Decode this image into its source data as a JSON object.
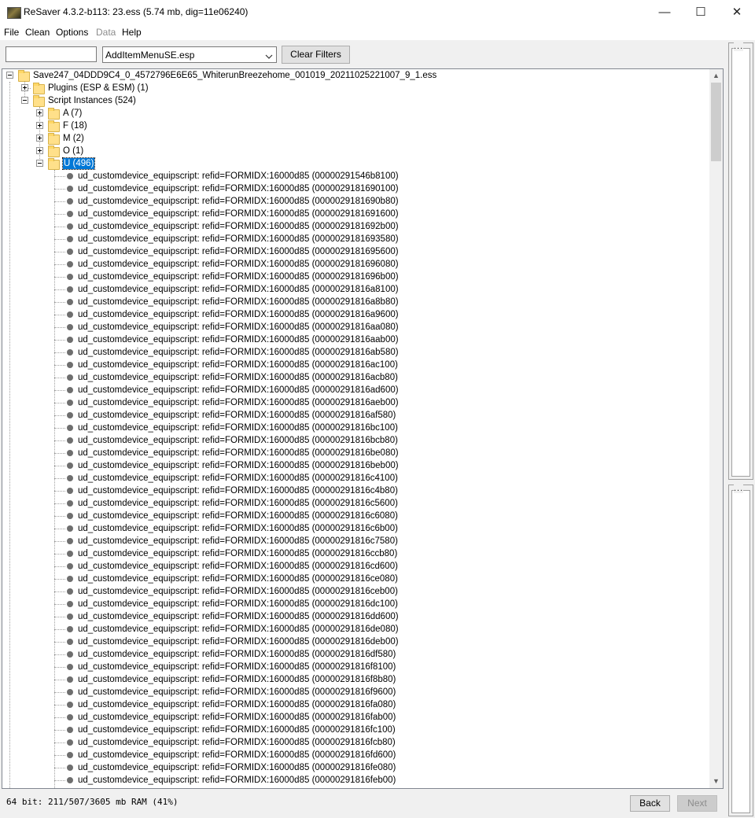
{
  "window": {
    "title": "ReSaver 4.3.2-b113: 23.ess (5.74 mb, dig=11e06240)",
    "minimize": "—",
    "maximize": "☐",
    "close": "✕"
  },
  "menu": [
    {
      "label": "File",
      "enabled": true
    },
    {
      "label": "Clean",
      "enabled": true
    },
    {
      "label": "Options",
      "enabled": true
    },
    {
      "label": "Data",
      "enabled": false
    },
    {
      "label": "Help",
      "enabled": true
    }
  ],
  "toolbar": {
    "filter_value": "",
    "plugin_select_value": "AddItemMenuSE.esp",
    "clear_filters_label": "Clear Filters"
  },
  "tree": {
    "root": "Save247_04DDD9C4_0_4572796E6E65_WhiterunBreezehome_001019_20211025221007_9_1.ess",
    "plugins": "Plugins (ESP & ESM) (1)",
    "script_instances": "Script Instances (524)",
    "groups": [
      {
        "label": "A (7)",
        "expanded": false
      },
      {
        "label": "F (18)",
        "expanded": false
      },
      {
        "label": "M (2)",
        "expanded": false
      },
      {
        "label": "O (1)",
        "expanded": false
      },
      {
        "label": "U (496)",
        "expanded": true,
        "selected": true
      }
    ],
    "item_prefix": "ud_customdevice_equipscript: refid=FORMIDX:16000d85",
    "items": [
      "(00000291546b8100)",
      "(0000029181690100)",
      "(00000291816​90b80)",
      "(0000029181691600)",
      "(0000029181692b00)",
      "(0000029181693580)",
      "(0000029181695600)",
      "(0000029181696080)",
      "(0000029181696b00)",
      "(00000291816a8100)",
      "(00000291816a8b80)",
      "(00000291816a9600)",
      "(00000291816aa080)",
      "(00000291816aab00)",
      "(00000291816ab580)",
      "(00000291816ac100)",
      "(00000291816acb80)",
      "(00000291816ad600)",
      "(00000291816aeb00)",
      "(00000291816af580)",
      "(00000291816bc100)",
      "(00000291816bcb80)",
      "(00000291816be080)",
      "(00000291816beb00)",
      "(00000291816c4100)",
      "(00000291816c4b80)",
      "(00000291816c5600)",
      "(00000291816c6080)",
      "(00000291816c6b00)",
      "(00000291816c7580)",
      "(00000291816ccb80)",
      "(00000291816cd600)",
      "(00000291816ce080)",
      "(00000291816ceb00)",
      "(00000291816dc100)",
      "(00000291816dd600)",
      "(00000291816de080)",
      "(00000291816deb00)",
      "(00000291816df580)",
      "(00000291816f8100)",
      "(00000291816f8b80)",
      "(00000291816f9600)",
      "(00000291816fa080)",
      "(00000291816fab00)",
      "(00000291816fc100)",
      "(00000291816fcb80)",
      "(00000291816fd600)",
      "(00000291816fe080)",
      "(00000291816feb00)"
    ]
  },
  "right_panels": {
    "top_label": "...",
    "bottom_label": "..."
  },
  "status": {
    "text": "64 bit: 211/507/3605 mb RAM (41%)",
    "back_label": "Back",
    "next_label": "Next"
  }
}
